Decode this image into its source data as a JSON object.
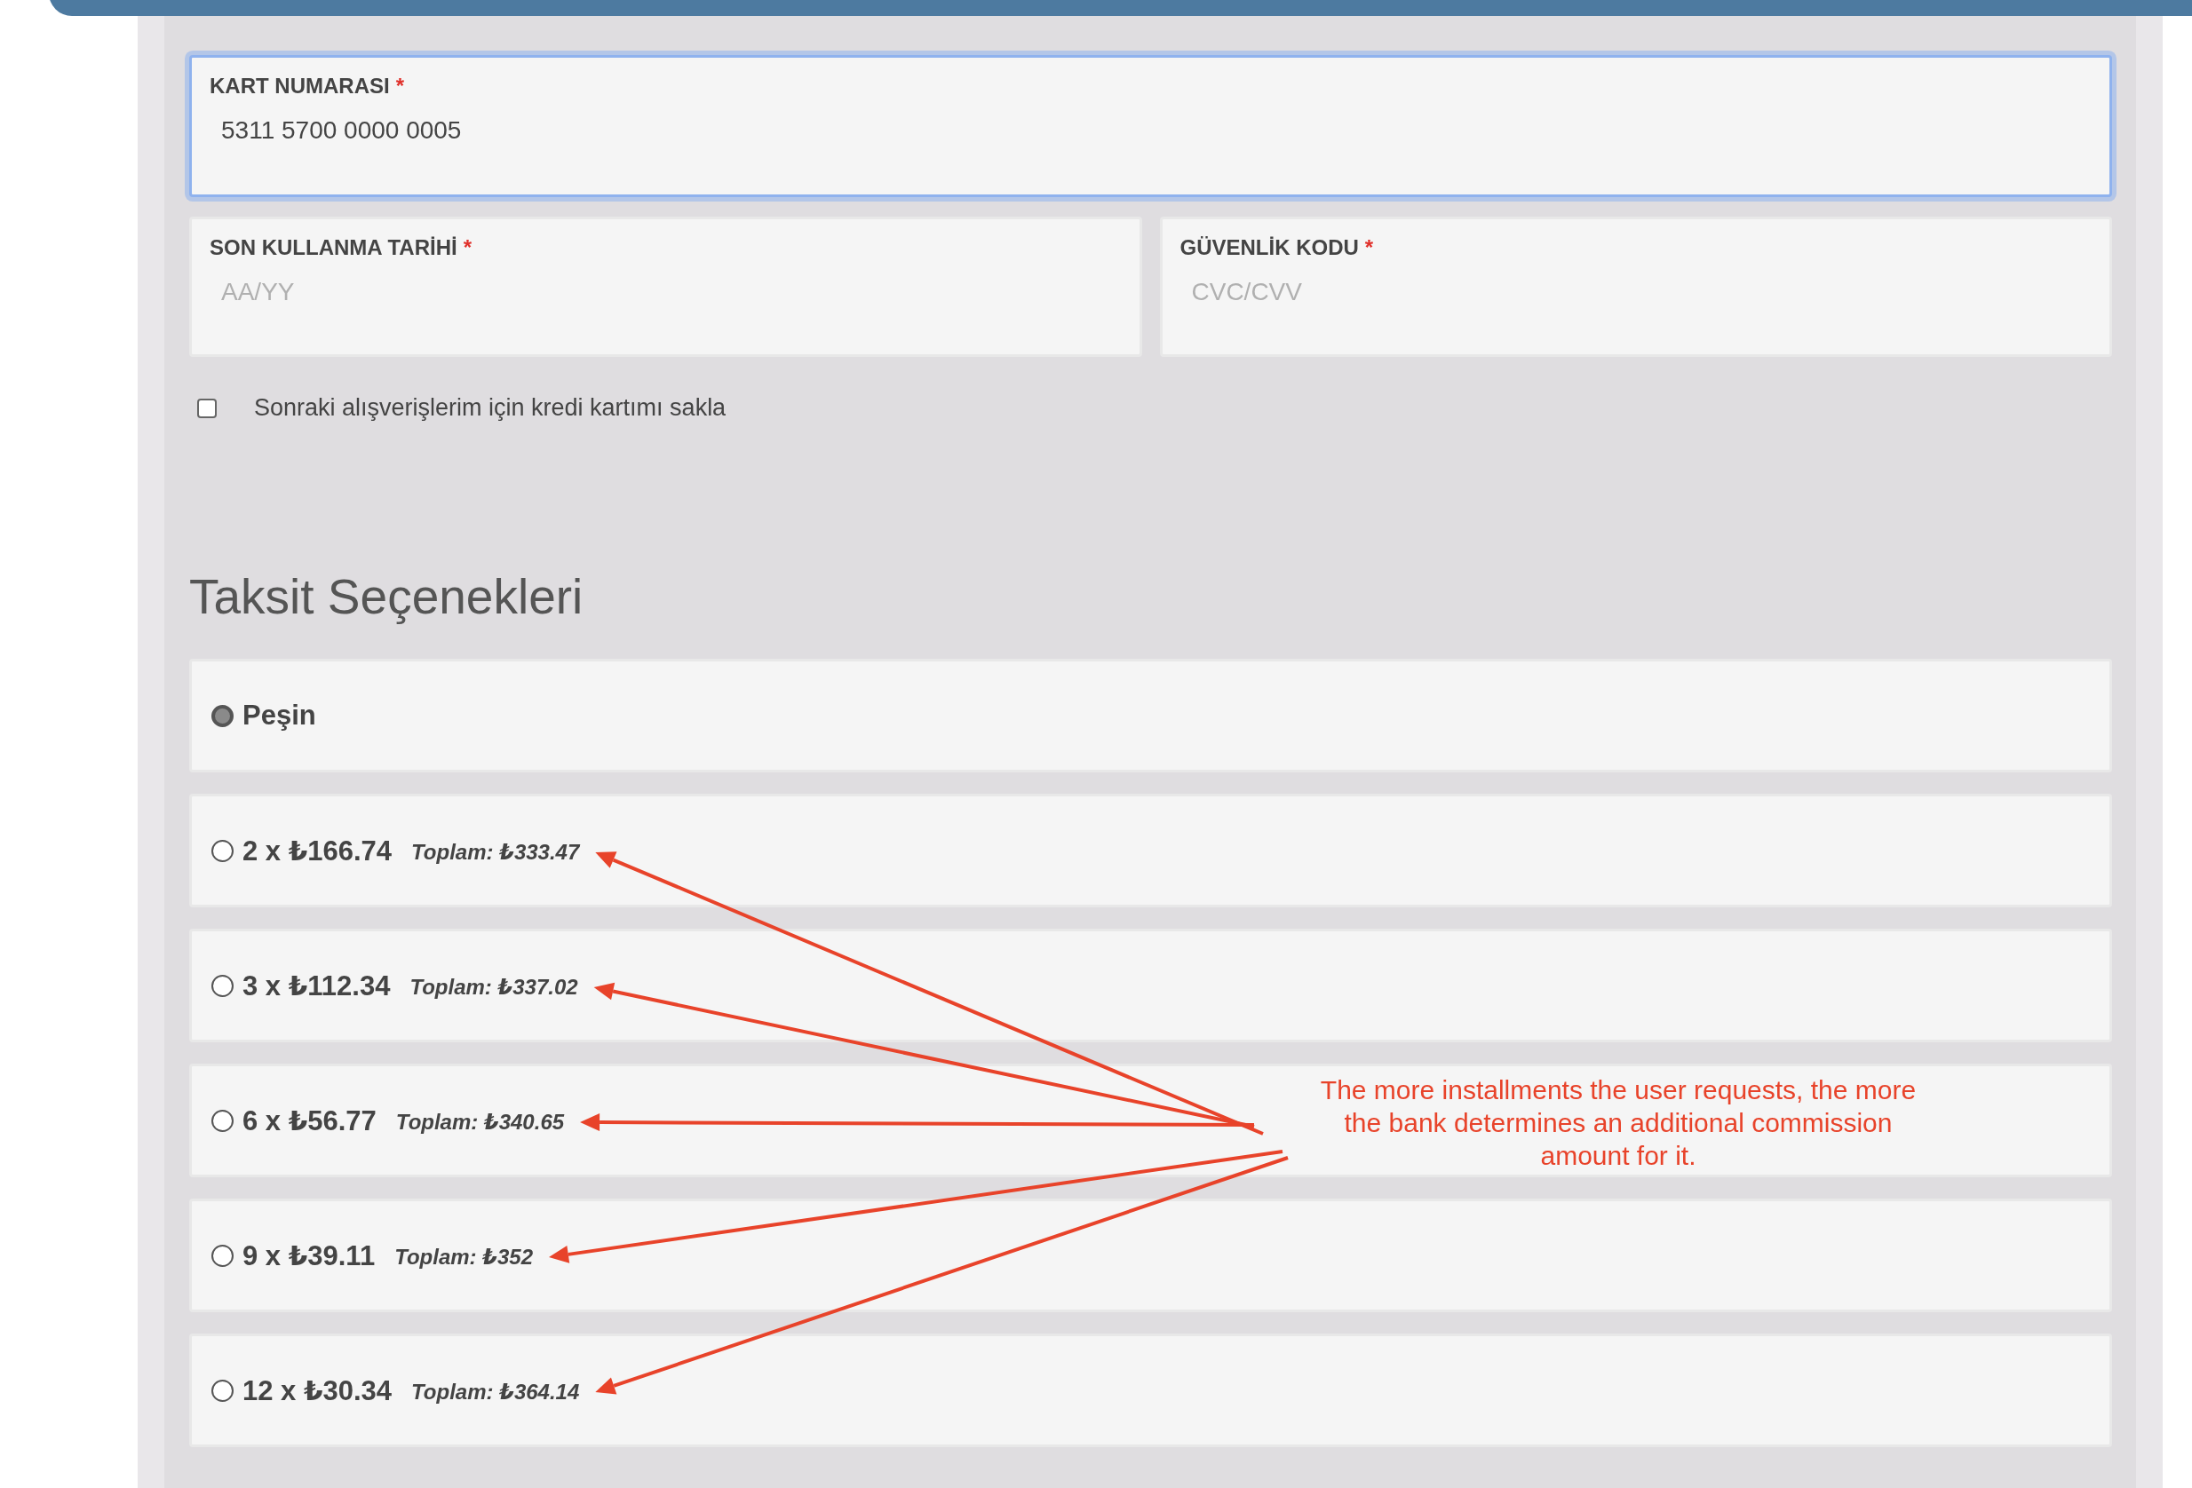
{
  "card_form": {
    "fields": [
      {
        "label": "KART NUMARASI",
        "required_mark": "*",
        "value": "5311 5700 0000 0005",
        "focused": true
      },
      {
        "label": "SON KULLANMA TARİHİ",
        "required_mark": "*",
        "placeholder": "AA/YY",
        "focused": false
      },
      {
        "label": "GÜVENLİK KODU",
        "required_mark": "*",
        "placeholder": "CVC/CVV",
        "focused": false
      }
    ],
    "save_card": {
      "label": "Sonraki alışverişlerim için kredi kartımı sakla",
      "checked": false
    }
  },
  "installments": {
    "title": "Taksit Seçenekleri",
    "options": [
      {
        "label": "Peşin",
        "selected": true
      },
      {
        "label": "2 x ₺166.74",
        "total": "Toplam: ₺333.47",
        "selected": false
      },
      {
        "label": "3 x ₺112.34",
        "total": "Toplam: ₺337.02",
        "selected": false
      },
      {
        "label": "6 x ₺56.77",
        "total": "Toplam: ₺340.65",
        "selected": false
      },
      {
        "label": "9 x ₺39.11",
        "total": "Toplam: ₺352",
        "selected": false
      },
      {
        "label": "12 x ₺30.34",
        "total": "Toplam: ₺364.14",
        "selected": false
      }
    ]
  },
  "annotation": {
    "text": "The more installments the user requests, the more the bank determines an additional commission amount for it."
  }
}
